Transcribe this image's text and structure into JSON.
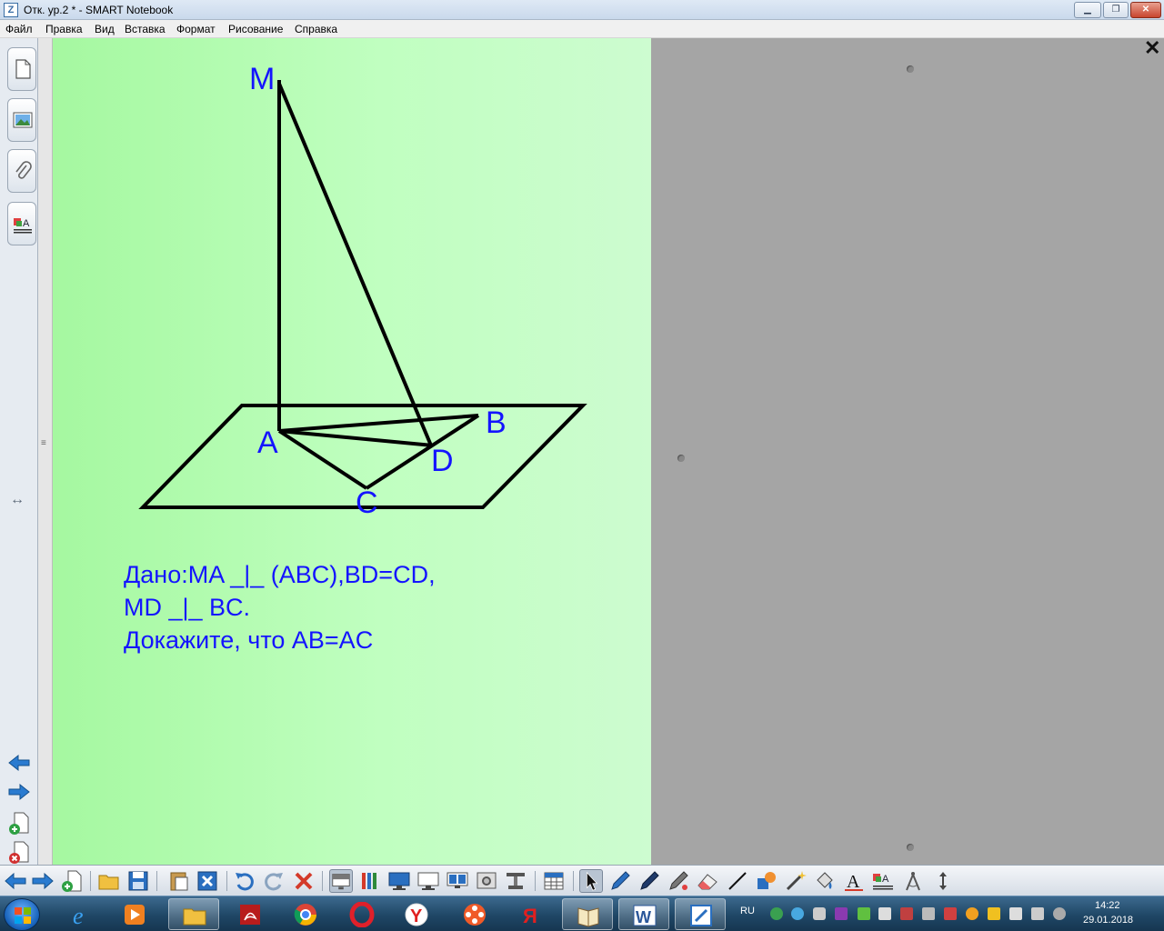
{
  "window": {
    "title": "Отк. ур.2 * - SMART Notebook",
    "app_icon_glyph": "Z"
  },
  "menu": [
    "Файл",
    "Правка",
    "Вид",
    "Вставка",
    "Формат",
    "Рисование",
    "Справка"
  ],
  "page": {
    "labels": {
      "M": "M",
      "A": "A",
      "B": "B",
      "C": "C",
      "D": "D"
    },
    "text": {
      "line1_given": "Дано:",
      "line1_rest": "MA _|_ (ABC),BD=CD,",
      "line2": "MD _|_ BC.",
      "line3": " Докажите, что AB=AC"
    },
    "ink_color": "#1414ff",
    "line_color": "#000000"
  },
  "sidebar": {
    "tabs": [
      "page-sorter-icon",
      "gallery-icon",
      "attachments-icon",
      "properties-icon"
    ],
    "move_glyph": "↔",
    "splitter_glyph": "≡"
  },
  "close_glyph": "✕",
  "toolbar": {
    "lang": "RU"
  },
  "taskbar": {
    "clock_time": "14:22",
    "clock_date": "29.01.2018"
  },
  "colors": {
    "canvas_left": "#a5f8a0",
    "canvas_right": "#cdfcd0",
    "gray": "#a5a5a5"
  }
}
